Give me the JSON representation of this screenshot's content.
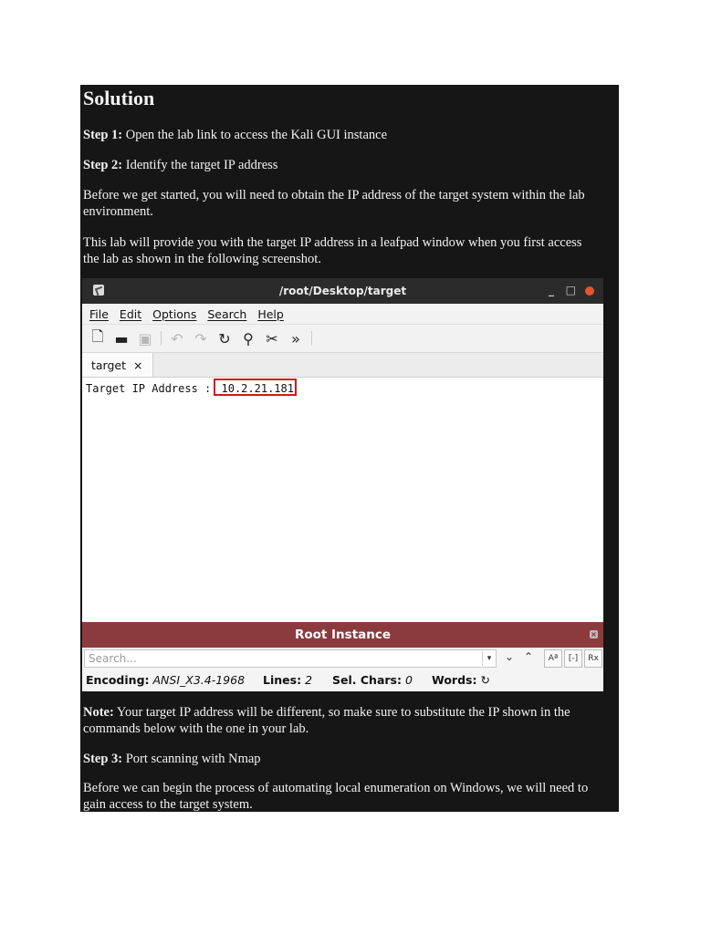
{
  "doc": {
    "heading": "Solution",
    "step1": {
      "label": "Step 1:",
      "text": "Open the lab link to access the Kali GUI instance"
    },
    "step2": {
      "label": "Step 2:",
      "text": "Identify the target IP address"
    },
    "para1_line1": "Before we get started, you will need to obtain the IP address of the target system within the lab",
    "para1_line2": "environment.",
    "para2_line1": "This lab will provide you with the target IP address in a leafpad window when you first access",
    "para2_line2": "the lab as shown in the following screenshot.",
    "note": {
      "label": "Note:",
      "line1": "Your target IP address will be different, so make sure to substitute the IP shown in the",
      "line2": "commands below with the one in your lab."
    },
    "step3": {
      "label": "Step 3:",
      "text": "Port scanning with Nmap"
    },
    "para3_line1": "Before we can begin the process of automating local enumeration on Windows, we will need to",
    "para3_line2": "gain access to the target system."
  },
  "window": {
    "title": "/root/Desktop/target",
    "menu": [
      "File",
      "Edit",
      "Options",
      "Search",
      "Help"
    ],
    "tab_label": "target",
    "tab_close": "×",
    "content_label": "Target IP Address : ",
    "ip_address": "10.2.21.181",
    "root_bar_title": "Root Instance",
    "search_placeholder": "Search...",
    "status": {
      "encoding_label": "Encoding:",
      "encoding_value": "ANSI_X3.4-1968",
      "lines_label": "Lines:",
      "lines_value": "2",
      "sel_label": "Sel. Chars:",
      "sel_value": "0",
      "words_label": "Words:"
    }
  }
}
